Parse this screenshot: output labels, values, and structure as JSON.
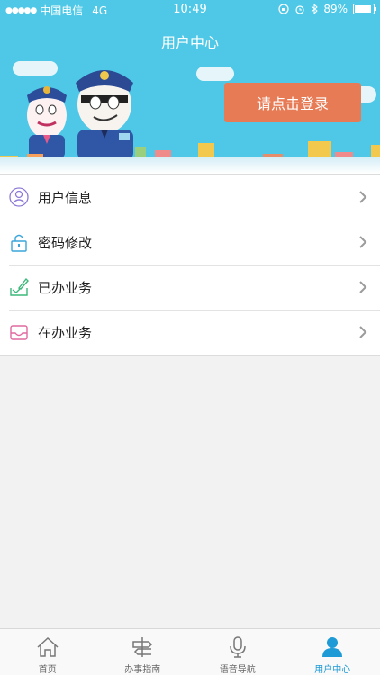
{
  "status_bar": {
    "carrier": "中国电信",
    "network": "4G",
    "time": "10:49",
    "battery": "89%"
  },
  "header": {
    "title": "用户中心",
    "login_label": "请点击登录"
  },
  "menu": {
    "items": [
      {
        "label": "用户信息",
        "icon": "user-icon"
      },
      {
        "label": "密码修改",
        "icon": "lock-icon"
      },
      {
        "label": "已办业务",
        "icon": "edit-icon"
      },
      {
        "label": "在办业务",
        "icon": "inbox-icon"
      }
    ]
  },
  "tabbar": {
    "tabs": [
      {
        "label": "首页",
        "icon": "home-icon"
      },
      {
        "label": "办事指南",
        "icon": "signpost-icon"
      },
      {
        "label": "语音导航",
        "icon": "microphone-icon"
      },
      {
        "label": "用户中心",
        "icon": "person-icon"
      }
    ],
    "active_index": 3
  },
  "colors": {
    "header_bg": "#4ec8e6",
    "login_button": "#e77b55",
    "tab_active": "#1e9ad6"
  }
}
